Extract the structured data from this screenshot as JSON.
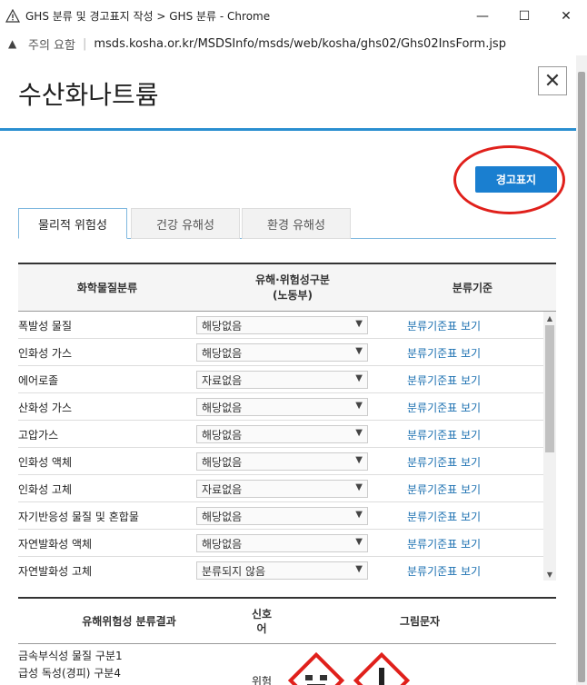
{
  "window": {
    "title": "GHS 분류 및 경고표지 작성 > GHS 분류 - Chrome",
    "minimize": "—",
    "maximize": "☐",
    "close": "✕"
  },
  "addressbar": {
    "security_label": "주의 요함",
    "url": "msds.kosha.or.kr/MSDSInfo/msds/web/kosha/ghs02/Ghs02InsForm.jsp"
  },
  "page": {
    "title": "수산화나트륨",
    "close_symbol": "✕",
    "warning_label_button": "경고표지"
  },
  "tabs": [
    {
      "label": "물리적 위험성",
      "active": true
    },
    {
      "label": "건강 유해성",
      "active": false
    },
    {
      "label": "환경 유해성",
      "active": false
    }
  ],
  "table": {
    "headers": {
      "classification": "화학물질분류",
      "category": "유해·위험성구분\n(노동부)",
      "criteria": "분류기준"
    },
    "rows": [
      {
        "name": "폭발성 물질",
        "value": "해당없음",
        "link": "분류기준표 보기"
      },
      {
        "name": "인화성 가스",
        "value": "해당없음",
        "link": "분류기준표 보기"
      },
      {
        "name": "에어로졸",
        "value": "자료없음",
        "link": "분류기준표 보기"
      },
      {
        "name": "산화성 가스",
        "value": "해당없음",
        "link": "분류기준표 보기"
      },
      {
        "name": "고압가스",
        "value": "해당없음",
        "link": "분류기준표 보기"
      },
      {
        "name": "인화성 액체",
        "value": "해당없음",
        "link": "분류기준표 보기"
      },
      {
        "name": "인화성 고체",
        "value": "자료없음",
        "link": "분류기준표 보기"
      },
      {
        "name": "자기반응성 물질 및 혼합물",
        "value": "해당없음",
        "link": "분류기준표 보기"
      },
      {
        "name": "자연발화성 액체",
        "value": "해당없음",
        "link": "분류기준표 보기"
      },
      {
        "name": "자연발화성 고체",
        "value": "분류되지 않음",
        "link": "분류기준표 보기"
      }
    ]
  },
  "result_table": {
    "headers": {
      "result": "유해위험성 분류결과",
      "signal": "신호\n어",
      "pictogram": "그림문자"
    },
    "results": [
      "금속부식성 물질 구분1",
      "급성 독성(경피) 구분4"
    ],
    "signal_word": "위험",
    "pictograms": [
      "corrosion-pictogram",
      "exclamation-pictogram"
    ]
  },
  "colors": {
    "accent": "#2a8fd0",
    "button": "#1a7fd0",
    "link": "#1a6fb0",
    "highlight_circle": "#e0201b"
  }
}
